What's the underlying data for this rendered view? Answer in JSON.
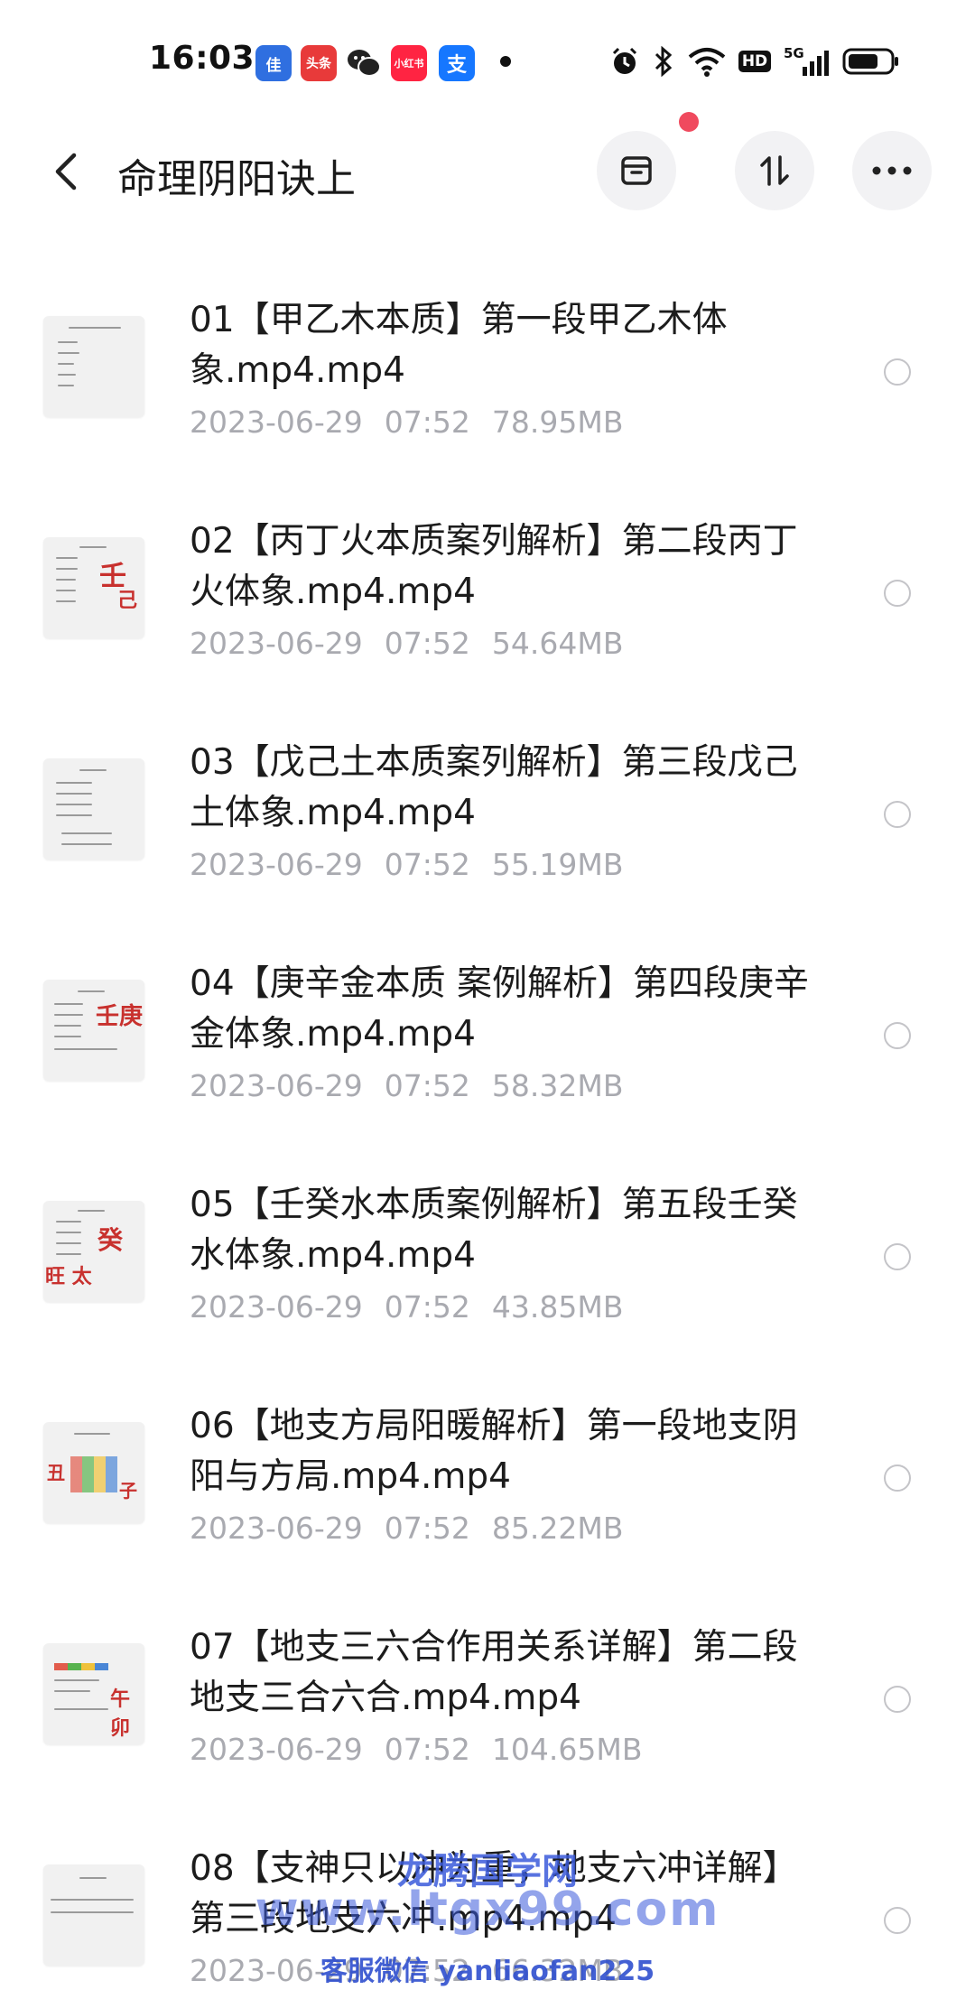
{
  "status_bar": {
    "time": "16:03",
    "notification_apps": [
      {
        "icon": "jia-app-icon",
        "label": "佳",
        "color": "#2f6fe0"
      },
      {
        "icon": "toutiao-icon",
        "label": "头条",
        "color": "#e83a3a"
      },
      {
        "icon": "wechat-icon",
        "label": "",
        "color": "#222222"
      },
      {
        "icon": "xiaohongshu-icon",
        "label": "小红书",
        "color": "#ff2442"
      },
      {
        "icon": "alipay-icon",
        "label": "支",
        "color": "#1677ff"
      }
    ],
    "network": "5G",
    "hd_label": "HD"
  },
  "header": {
    "title": "命理阴阳诀上"
  },
  "files": [
    {
      "name": "01【甲乙木本质】第一段甲乙木体象.mp4.mp4",
      "date": "2023-06-29",
      "time": "07:52",
      "size": "78.95MB"
    },
    {
      "name": "02【丙丁火本质案列解析】第二段丙丁火体象.mp4.mp4",
      "date": "2023-06-29",
      "time": "07:52",
      "size": "54.64MB"
    },
    {
      "name": "03【戊己土本质案列解析】第三段戊己土体象.mp4.mp4",
      "date": "2023-06-29",
      "time": "07:52",
      "size": "55.19MB"
    },
    {
      "name": "04【庚辛金本质 案例解析】第四段庚辛金体象.mp4.mp4",
      "date": "2023-06-29",
      "time": "07:52",
      "size": "58.32MB"
    },
    {
      "name": "05【壬癸水本质案例解析】第五段壬癸水体象.mp4.mp4",
      "date": "2023-06-29",
      "time": "07:52",
      "size": "43.85MB"
    },
    {
      "name": "06【地支方局阳暖解析】第一段地支阴阳与方局.mp4.mp4",
      "date": "2023-06-29",
      "time": "07:52",
      "size": "85.22MB"
    },
    {
      "name": "07【地支三六合作用关系详解】第二段地支三合六合.mp4.mp4",
      "date": "2023-06-29",
      "time": "07:52",
      "size": "104.65MB"
    },
    {
      "name": "08【支神只以冲为重，地支六冲详解】第三段地支六冲.mp4.mp4",
      "date": "2023-06-29",
      "time": "07:52",
      "size": "66.32MB"
    }
  ],
  "watermark": {
    "line1": "龙腾国学网",
    "line2": "www.ltgx99.com",
    "line3": "客服微信 yanliaofan225"
  }
}
